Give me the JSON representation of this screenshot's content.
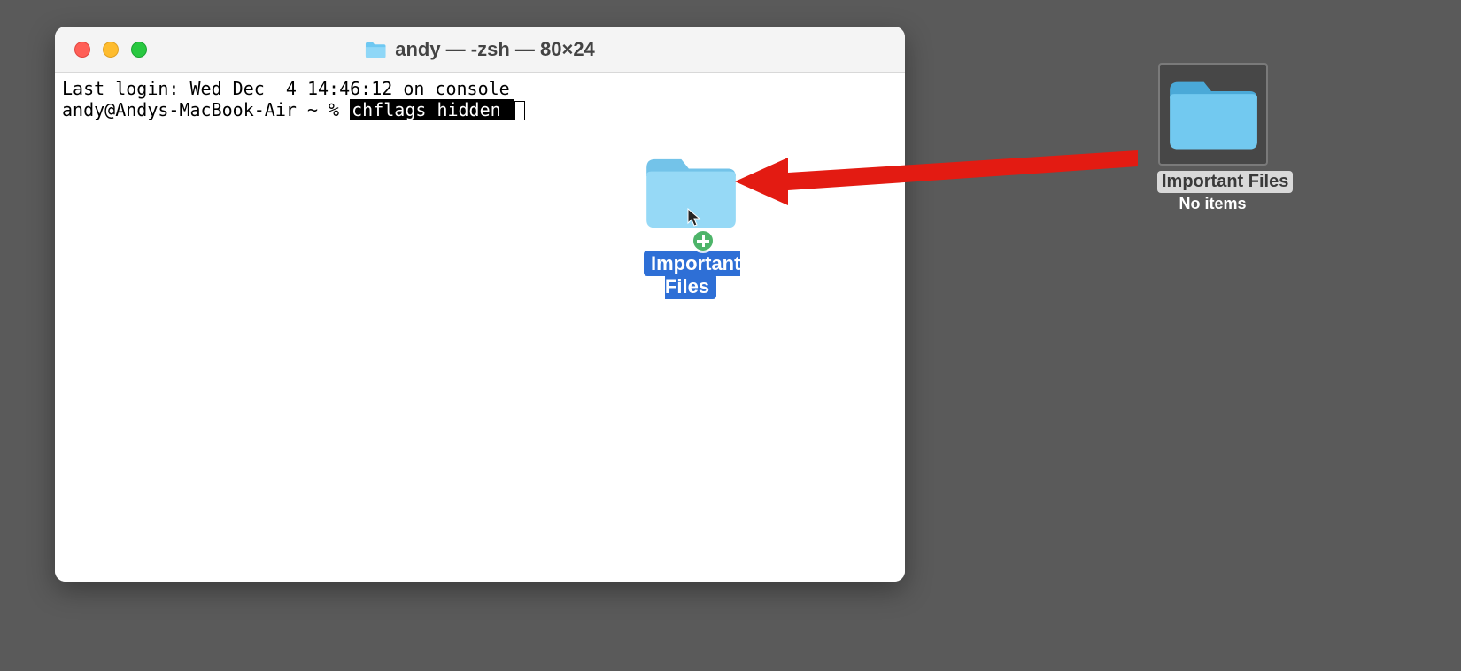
{
  "terminal": {
    "title": "andy — -zsh — 80×24",
    "line1": "Last login: Wed Dec  4 14:46:12 on console",
    "prompt": "andy@Andys-MacBook-Air ~ % ",
    "command_highlight": "chflags hidden "
  },
  "drag_folder": {
    "label": "Important Files"
  },
  "desktop_folder": {
    "label": "Important Files",
    "subtitle": "No items"
  }
}
